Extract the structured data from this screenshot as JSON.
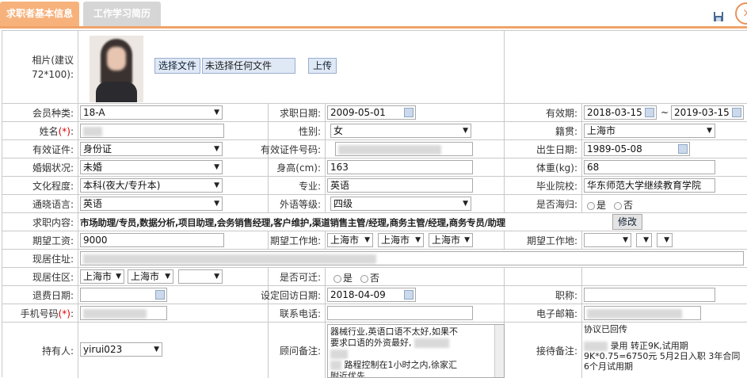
{
  "tabs": {
    "active": "求职者基本信息",
    "inactive": "工作学习简历"
  },
  "photo": {
    "label": "相片(建议72*100):",
    "choose_button": "选择文件",
    "no_file": "未选择任何文件",
    "upload_button": "上传"
  },
  "row1": {
    "membership_label": "会员种类:",
    "membership_value": "18-A",
    "apply_date_label": "求职日期:",
    "apply_date_value": "2009-05-01",
    "validity_label": "有效期:",
    "validity_start": "2018-03-15",
    "validity_sep": "~",
    "validity_end": "2019-03-15"
  },
  "row2": {
    "name_label": "姓名",
    "name_req": "(*)",
    "name_colon": ":",
    "gender_label": "性别:",
    "gender_value": "女",
    "origin_label": "籍贯:",
    "origin_value": "上海市"
  },
  "row3": {
    "id_type_label": "有效证件:",
    "id_type_value": "身份证",
    "id_number_label": "有效证件号码:",
    "birth_label": "出生日期:",
    "birth_value": "1989-05-08"
  },
  "row4": {
    "marital_label": "婚姻状况:",
    "marital_value": "未婚",
    "height_label": "身高(cm):",
    "height_value": "163",
    "weight_label": "体重(kg):",
    "weight_value": "68"
  },
  "row5": {
    "education_label": "文化程度:",
    "education_value": "本科(夜大/专升本)",
    "major_label": "专业:",
    "major_value": "英语",
    "school_label": "毕业院校:",
    "school_value": "华东师范大学继续教育学院"
  },
  "row6": {
    "language_label": "通晓语言:",
    "language_value": "英语",
    "lang_level_label": "外语等级:",
    "lang_level_value": "四级",
    "overseas_label": "是否海归:",
    "yes": "是",
    "no": "否"
  },
  "row7": {
    "job_label": "求职内容:",
    "job_value": "市场助理/专员,数据分析,项目助理,会务销售经理,客户维护,渠道销售主管/经理,商务主管/经理,商务专员/助理",
    "modify_button": "修改"
  },
  "row8": {
    "salary_label": "期望工资:",
    "salary_value": "9000",
    "work_location_label": "期望工作地:",
    "loc1": "上海市",
    "loc2": "上海市",
    "loc3": "上海市",
    "work_location_label2": "期望工作地:"
  },
  "row9": {
    "address_label": "现居住址:"
  },
  "row10": {
    "district_label": "现居住区:",
    "d1": "上海市",
    "d2": "上海市",
    "relocate_label": "是否可迁:",
    "yes": "是",
    "no": "否"
  },
  "row11": {
    "refund_label": "退费日期:",
    "visit_label": "设定回访日期:",
    "visit_value": "2018-04-09",
    "title_label": "职称:"
  },
  "row12": {
    "mobile_label": "手机号码",
    "mobile_req": "(*)",
    "mobile_colon": ":",
    "phone_label": "联系电话:",
    "email_label": "电子邮箱:"
  },
  "row13": {
    "owner_label": "持有人:",
    "owner_value": "yirui023",
    "consultant_label": "顾问备注:",
    "consultant_note_1": "器械行业,英语口语不太好,如果不",
    "consultant_note_2": "要求口语的外资最好,",
    "consultant_note_3": "路程控制在1小时之内,徐家汇",
    "consultant_note_4": "附近优先",
    "reception_label": "接待备注:",
    "reception_note_1": "协议已回传",
    "reception_note_2": "录用 转正9K,试用期",
    "reception_note_3": "9K*0.75=6750元 5月2日入职 3年合同",
    "reception_note_4": "6个月试用期"
  }
}
